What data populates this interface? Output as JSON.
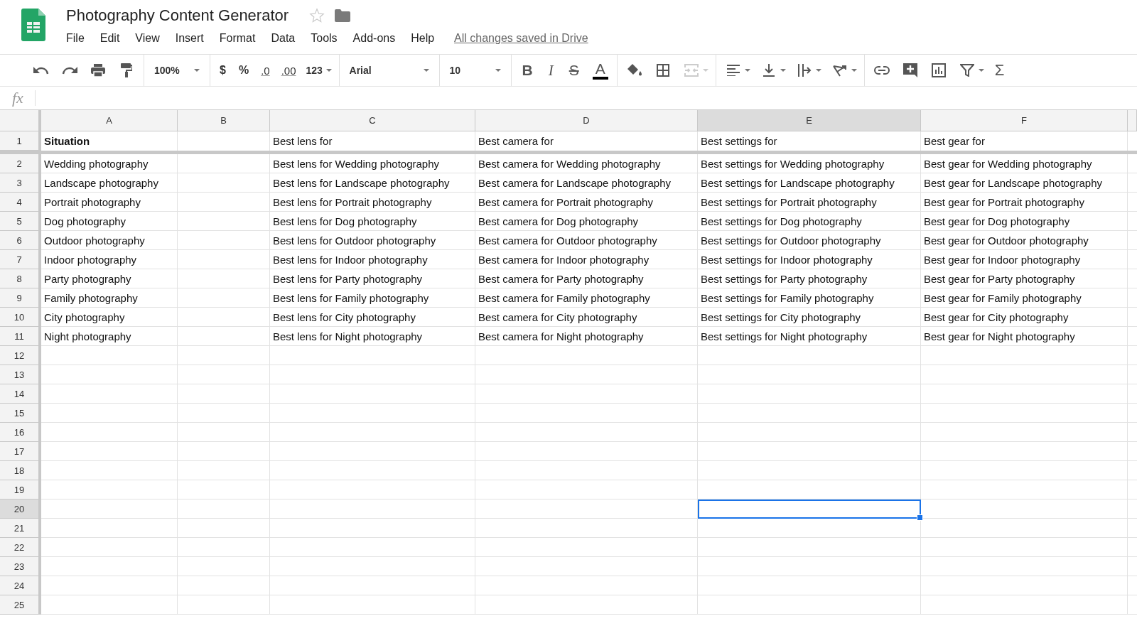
{
  "document": {
    "title": "Photography Content Generator",
    "starred": false,
    "save_status": "All changes saved in Drive"
  },
  "menu": [
    "File",
    "Edit",
    "View",
    "Insert",
    "Format",
    "Data",
    "Tools",
    "Add-ons",
    "Help"
  ],
  "toolbar": {
    "zoom": "100%",
    "currency": "$",
    "percent": "%",
    "decimal_decrease": ".0",
    "decimal_increase": ".00",
    "number_format": "123",
    "font": "Arial",
    "font_size": "10",
    "bold": "B",
    "italic": "I",
    "strikethrough": "S",
    "text_color": "A",
    "merge_disabled": true,
    "functions": "Σ"
  },
  "formula_bar": {
    "label": "fx"
  },
  "columns": [
    {
      "letter": "A",
      "selected": false
    },
    {
      "letter": "B",
      "selected": false
    },
    {
      "letter": "C",
      "selected": false
    },
    {
      "letter": "D",
      "selected": false
    },
    {
      "letter": "E",
      "selected": true
    },
    {
      "letter": "F",
      "selected": false
    }
  ],
  "rows": [
    {
      "number": "1",
      "selected": false,
      "cells": {
        "A": {
          "text": "Situation",
          "bold": true
        },
        "C": {
          "text": "Best lens for",
          "bold": false
        },
        "D": {
          "text": "Best camera for",
          "bold": false
        },
        "E": {
          "text": "Best settings for",
          "bold": false
        },
        "F": {
          "text": "Best gear for",
          "bold": false
        }
      }
    },
    {
      "number": "2",
      "selected": false,
      "cells": {
        "A": {
          "text": "Wedding photography",
          "bold": false
        },
        "C": {
          "text": "Best lens for Wedding photography",
          "bold": false
        },
        "D": {
          "text": "Best camera for Wedding photography",
          "bold": false
        },
        "E": {
          "text": "Best settings for Wedding photography",
          "bold": false
        },
        "F": {
          "text": "Best gear for Wedding photography",
          "bold": false
        }
      }
    },
    {
      "number": "3",
      "selected": false,
      "cells": {
        "A": {
          "text": "Landscape photography",
          "bold": false
        },
        "C": {
          "text": "Best lens for Landscape photography",
          "bold": false
        },
        "D": {
          "text": "Best camera for Landscape photography",
          "bold": false
        },
        "E": {
          "text": "Best settings for Landscape photography",
          "bold": false
        },
        "F": {
          "text": "Best gear for Landscape photography",
          "bold": false
        }
      }
    },
    {
      "number": "4",
      "selected": false,
      "cells": {
        "A": {
          "text": "Portrait photography",
          "bold": false
        },
        "C": {
          "text": "Best lens for Portrait photography",
          "bold": false
        },
        "D": {
          "text": "Best camera for Portrait photography",
          "bold": false
        },
        "E": {
          "text": "Best settings for Portrait photography",
          "bold": false
        },
        "F": {
          "text": "Best gear for Portrait photography",
          "bold": false
        }
      }
    },
    {
      "number": "5",
      "selected": false,
      "cells": {
        "A": {
          "text": "Dog photography",
          "bold": false
        },
        "C": {
          "text": "Best lens for Dog photography",
          "bold": false
        },
        "D": {
          "text": "Best camera for Dog photography",
          "bold": false
        },
        "E": {
          "text": "Best settings for Dog photography",
          "bold": false
        },
        "F": {
          "text": "Best gear for Dog photography",
          "bold": false
        }
      }
    },
    {
      "number": "6",
      "selected": false,
      "cells": {
        "A": {
          "text": "Outdoor photography",
          "bold": false
        },
        "C": {
          "text": "Best lens for Outdoor photography",
          "bold": false
        },
        "D": {
          "text": "Best camera for Outdoor photography",
          "bold": false
        },
        "E": {
          "text": "Best settings for Outdoor photography",
          "bold": false
        },
        "F": {
          "text": "Best gear for Outdoor photography",
          "bold": false
        }
      }
    },
    {
      "number": "7",
      "selected": false,
      "cells": {
        "A": {
          "text": "Indoor photography",
          "bold": false
        },
        "C": {
          "text": "Best lens for Indoor photography",
          "bold": false
        },
        "D": {
          "text": "Best camera for Indoor photography",
          "bold": false
        },
        "E": {
          "text": "Best settings for Indoor photography",
          "bold": false
        },
        "F": {
          "text": "Best gear for Indoor photography",
          "bold": false
        }
      }
    },
    {
      "number": "8",
      "selected": false,
      "cells": {
        "A": {
          "text": "Party photography",
          "bold": false
        },
        "C": {
          "text": "Best lens for Party photography",
          "bold": false
        },
        "D": {
          "text": "Best camera for Party photography",
          "bold": false
        },
        "E": {
          "text": "Best settings for Party photography",
          "bold": false
        },
        "F": {
          "text": "Best gear for Party photography",
          "bold": false
        }
      }
    },
    {
      "number": "9",
      "selected": false,
      "cells": {
        "A": {
          "text": "Family photography",
          "bold": false
        },
        "C": {
          "text": "Best lens for Family photography",
          "bold": false
        },
        "D": {
          "text": "Best camera for Family photography",
          "bold": false
        },
        "E": {
          "text": "Best settings for Family photography",
          "bold": false
        },
        "F": {
          "text": "Best gear for Family photography",
          "bold": false
        }
      }
    },
    {
      "number": "10",
      "selected": false,
      "cells": {
        "A": {
          "text": "City photography",
          "bold": false
        },
        "C": {
          "text": "Best lens for City photography",
          "bold": false
        },
        "D": {
          "text": "Best camera for City photography",
          "bold": false
        },
        "E": {
          "text": "Best settings for City photography",
          "bold": false
        },
        "F": {
          "text": "Best gear for City photography",
          "bold": false
        }
      }
    },
    {
      "number": "11",
      "selected": false,
      "cells": {
        "A": {
          "text": "Night photography",
          "bold": false
        },
        "C": {
          "text": "Best lens for Night photography",
          "bold": false
        },
        "D": {
          "text": "Best camera for Night photography",
          "bold": false
        },
        "E": {
          "text": "Best settings for Night photography",
          "bold": false
        },
        "F": {
          "text": "Best gear for Night photography",
          "bold": false
        }
      }
    },
    {
      "number": "12",
      "selected": false
    },
    {
      "number": "13",
      "selected": false
    },
    {
      "number": "14",
      "selected": false
    },
    {
      "number": "15",
      "selected": false
    },
    {
      "number": "16",
      "selected": false
    },
    {
      "number": "17",
      "selected": false
    },
    {
      "number": "18",
      "selected": false
    },
    {
      "number": "19",
      "selected": false
    },
    {
      "number": "20",
      "selected": true
    },
    {
      "number": "21",
      "selected": false
    },
    {
      "number": "22",
      "selected": false
    },
    {
      "number": "23",
      "selected": false
    },
    {
      "number": "24",
      "selected": false
    },
    {
      "number": "25",
      "selected": false
    }
  ]
}
